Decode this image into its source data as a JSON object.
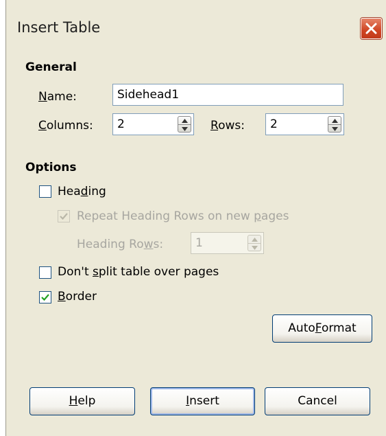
{
  "dialog": {
    "title": "Insert Table",
    "close_icon": "close-icon"
  },
  "general": {
    "heading": "General",
    "name_label_key": "N",
    "name_label_rest": "ame:",
    "name_value": "Sidehead1",
    "columns_label_key": "C",
    "columns_label_rest": "olumns:",
    "columns_value": "2",
    "rows_label_key": "R",
    "rows_label_rest": "ows:",
    "rows_value": "2"
  },
  "options": {
    "heading": "Options",
    "heading_checkbox": {
      "pre": "Hea",
      "key": "d",
      "post": "ing",
      "checked": false
    },
    "repeat_heading": {
      "pre": "Repeat Heading Rows on new ",
      "key": "p",
      "post": "ages",
      "checked": true,
      "enabled": false
    },
    "heading_rows": {
      "pre": "Heading Ro",
      "key": "w",
      "post": "s:",
      "value": "1",
      "enabled": false
    },
    "dont_split": {
      "pre": "Don't ",
      "key": "s",
      "post": "plit table over pages",
      "checked": false
    },
    "border": {
      "pre": "",
      "key": "B",
      "post": "order",
      "checked": true
    }
  },
  "buttons": {
    "autoformat": {
      "pre": "Auto",
      "key": "F",
      "post": "ormat"
    },
    "help": {
      "pre": "",
      "key": "H",
      "post": "elp"
    },
    "insert": {
      "pre": "",
      "key": "I",
      "post": "nsert"
    },
    "cancel": {
      "pre": "Cancel",
      "key": "",
      "post": ""
    }
  }
}
